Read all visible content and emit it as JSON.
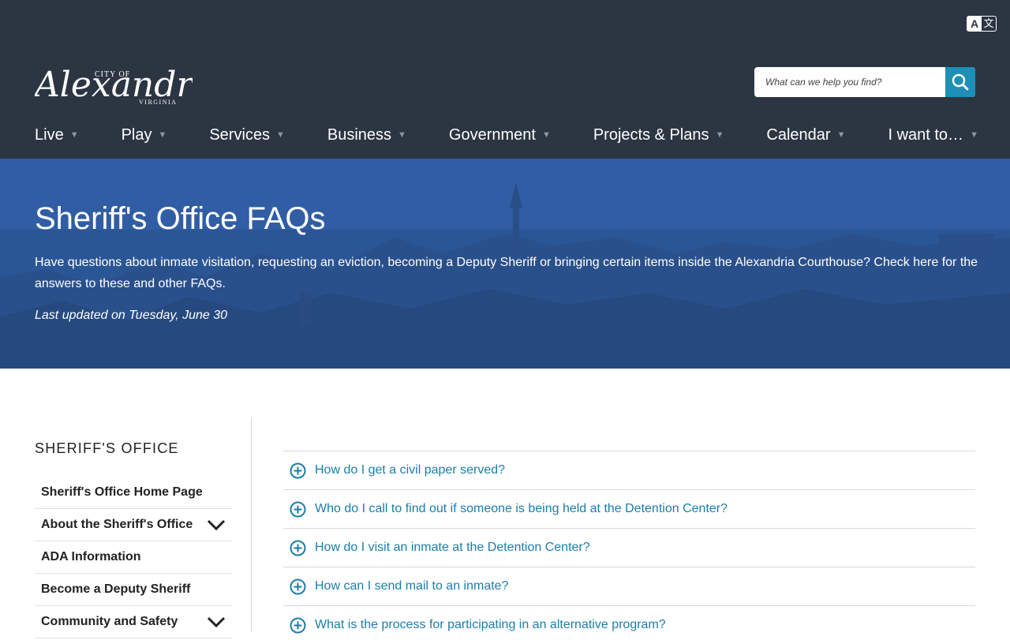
{
  "header": {
    "logo": {
      "city_of": "CITY OF",
      "name": "Alexandria",
      "state": "VIRGINIA"
    },
    "translate_icon": "translate-icon",
    "search": {
      "placeholder": "What can we help you find?",
      "icon": "search-icon"
    },
    "nav": [
      {
        "label": "Live"
      },
      {
        "label": "Play"
      },
      {
        "label": "Services"
      },
      {
        "label": "Business"
      },
      {
        "label": "Government"
      },
      {
        "label": "Projects & Plans"
      },
      {
        "label": "Calendar"
      },
      {
        "label": "I want to…"
      }
    ],
    "nav_caret": "▼"
  },
  "hero": {
    "title": "Sheriff's Office FAQs",
    "description": "Have questions about inmate visitation, requesting an eviction, becoming a Deputy Sheriff or bringing certain items inside the Alexandria Courthouse? Check here for the answers to these and other FAQs.",
    "updated": "Last updated on Tuesday, June 30"
  },
  "sidebar": {
    "heading": "SHERIFF'S OFFICE",
    "items": [
      {
        "label": "Sheriff's Office Home Page",
        "expandable": false
      },
      {
        "label": "About the Sheriff's Office",
        "expandable": true
      },
      {
        "label": "ADA Information",
        "expandable": false
      },
      {
        "label": "Become a Deputy Sheriff",
        "expandable": false
      },
      {
        "label": "Community and Safety",
        "expandable": true
      }
    ]
  },
  "faq": {
    "items": [
      {
        "question": "How do I get a civil paper served?"
      },
      {
        "question": "Who do I call to find out if someone is being held at the Detention Center?"
      },
      {
        "question": "How do I visit an inmate at the Detention Center?"
      },
      {
        "question": "How can I send mail to an inmate?"
      },
      {
        "question": "What is the process for participating in an alternative program?"
      }
    ]
  },
  "colors": {
    "header_bg": "#2c3542",
    "accent": "#1e8fb8",
    "link": "#1b7ea8",
    "hero_blue": "#2f5da7"
  }
}
